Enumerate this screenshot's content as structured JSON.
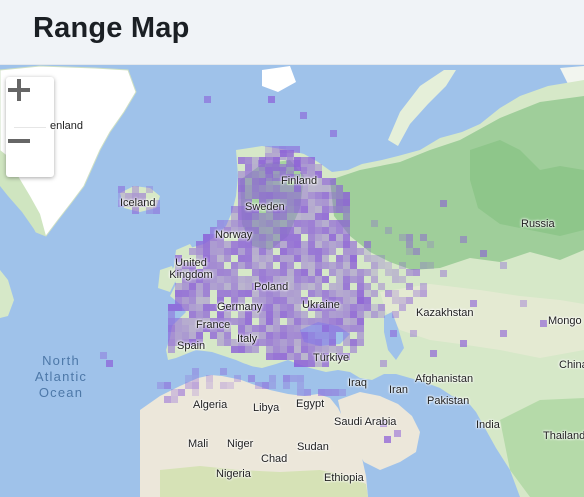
{
  "header": {
    "title": "Range Map"
  },
  "controls": {
    "zoom_in": "+",
    "zoom_out": "−"
  },
  "map": {
    "colors": {
      "ocean": "#9fc2ea",
      "land": "#d6e8c8",
      "forest": "#9fce9a",
      "ice": "#ffffff",
      "desert": "#ece7da",
      "range": "#8a5cd8"
    },
    "ocean_label": "North Atlantic Ocean",
    "labels": [
      {
        "key": "greenland",
        "text": "enland"
      },
      {
        "key": "iceland",
        "text": "Iceland"
      },
      {
        "key": "finland",
        "text": "Finland"
      },
      {
        "key": "sweden",
        "text": "Sweden"
      },
      {
        "key": "norway",
        "text": "Norway"
      },
      {
        "key": "uk",
        "text": "United Kingdom"
      },
      {
        "key": "poland",
        "text": "Poland"
      },
      {
        "key": "germany",
        "text": "Germany"
      },
      {
        "key": "ukraine",
        "text": "Ukraine"
      },
      {
        "key": "france",
        "text": "France"
      },
      {
        "key": "spain",
        "text": "Spain"
      },
      {
        "key": "italy",
        "text": "Italy"
      },
      {
        "key": "turkiye",
        "text": "Türkiye"
      },
      {
        "key": "russia",
        "text": "Russia"
      },
      {
        "key": "kazakhstan",
        "text": "Kazakhstan"
      },
      {
        "key": "mongolia",
        "text": "Mongo"
      },
      {
        "key": "afghanistan",
        "text": "Afghanistan"
      },
      {
        "key": "china",
        "text": "China"
      },
      {
        "key": "iraq",
        "text": "Iraq"
      },
      {
        "key": "iran",
        "text": "Iran"
      },
      {
        "key": "pakistan",
        "text": "Pakistan"
      },
      {
        "key": "algeria",
        "text": "Algeria"
      },
      {
        "key": "libya",
        "text": "Libya"
      },
      {
        "key": "egypt",
        "text": "Egypt"
      },
      {
        "key": "saudi",
        "text": "Saudi Arabia"
      },
      {
        "key": "india",
        "text": "India"
      },
      {
        "key": "thailand",
        "text": "Thailand"
      },
      {
        "key": "mali",
        "text": "Mali"
      },
      {
        "key": "niger",
        "text": "Niger"
      },
      {
        "key": "sudan",
        "text": "Sudan"
      },
      {
        "key": "chad",
        "text": "Chad"
      },
      {
        "key": "nigeria",
        "text": "Nigeria"
      },
      {
        "key": "ethiopia",
        "text": "Ethiopia"
      }
    ]
  }
}
